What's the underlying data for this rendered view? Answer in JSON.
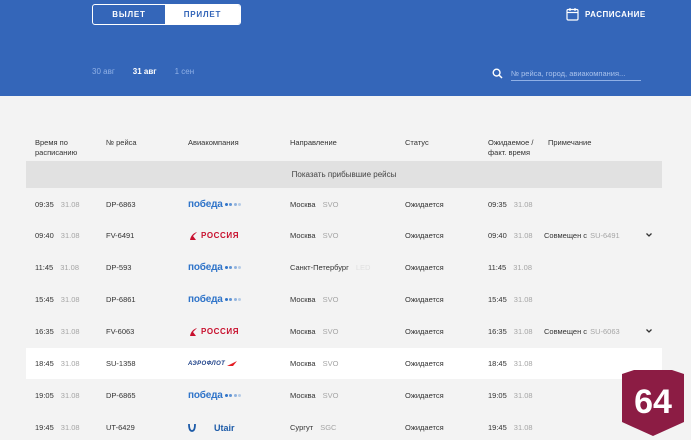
{
  "tabs": {
    "departure": "ВЫЛЕТ",
    "arrival": "ПРИЛЕТ"
  },
  "schedule_label": "РАСПИСАНИЕ",
  "dates": [
    "30 авг",
    "31 авг",
    "1 сен"
  ],
  "search": {
    "placeholder": "№ рейса, город, авиакомпания..."
  },
  "columns": {
    "scheduled": "Время по расписанию",
    "flight": "№ рейса",
    "airline": "Авиакомпания",
    "direction": "Направление",
    "status": "Статус",
    "expected": "Ожидаемое / факт. время",
    "note": "Примечание"
  },
  "show_arrived": "Показать прибывшие рейсы",
  "rows": [
    {
      "time": "09:35",
      "date": "31.08",
      "flight": "DP-6863",
      "airline": "pobeda",
      "city": "Москва",
      "code": "SVO",
      "status": "Ожидается",
      "exp_time": "09:35",
      "exp_date": "31.08",
      "note": "",
      "note_code": ""
    },
    {
      "time": "09:40",
      "date": "31.08",
      "flight": "FV-6491",
      "airline": "rossiya",
      "city": "Москва",
      "code": "SVO",
      "status": "Ожидается",
      "exp_time": "09:40",
      "exp_date": "31.08",
      "note": "Совмещен с",
      "note_code": "SU-6491"
    },
    {
      "time": "11:45",
      "date": "31.08",
      "flight": "DP-593",
      "airline": "pobeda",
      "city": "Санкт-Петербург",
      "code": "LED",
      "status": "Ожидается",
      "exp_time": "11:45",
      "exp_date": "31.08",
      "note": "",
      "note_code": ""
    },
    {
      "time": "15:45",
      "date": "31.08",
      "flight": "DP-6861",
      "airline": "pobeda",
      "city": "Москва",
      "code": "SVO",
      "status": "Ожидается",
      "exp_time": "15:45",
      "exp_date": "31.08",
      "note": "",
      "note_code": ""
    },
    {
      "time": "16:35",
      "date": "31.08",
      "flight": "FV-6063",
      "airline": "rossiya",
      "city": "Москва",
      "code": "SVO",
      "status": "Ожидается",
      "exp_time": "16:35",
      "exp_date": "31.08",
      "note": "Совмещен с",
      "note_code": "SU-6063"
    },
    {
      "time": "18:45",
      "date": "31.08",
      "flight": "SU-1358",
      "airline": "aeroflot",
      "city": "Москва",
      "code": "SVO",
      "status": "Ожидается",
      "exp_time": "18:45",
      "exp_date": "31.08",
      "note": "",
      "note_code": ""
    },
    {
      "time": "19:05",
      "date": "31.08",
      "flight": "DP-6865",
      "airline": "pobeda",
      "city": "Москва",
      "code": "SVO",
      "status": "Ожидается",
      "exp_time": "19:05",
      "exp_date": "31.08",
      "note": "",
      "note_code": ""
    },
    {
      "time": "19:45",
      "date": "31.08",
      "flight": "UT-6429",
      "airline": "utair",
      "city": "Сургут",
      "code": "SGC",
      "status": "Ожидается",
      "exp_time": "19:45",
      "exp_date": "31.08",
      "note": "",
      "note_code": ""
    }
  ],
  "logos": {
    "pobeda": "победа",
    "rossiya": "РОССИЯ",
    "aeroflot": "АЭРОФЛОТ",
    "utair": "Utair"
  },
  "badge": "64",
  "colors": {
    "header": "#3466b9",
    "badge": "#8c1c44",
    "pobeda": "#2f74c9",
    "rossiya": "#c8102e"
  }
}
